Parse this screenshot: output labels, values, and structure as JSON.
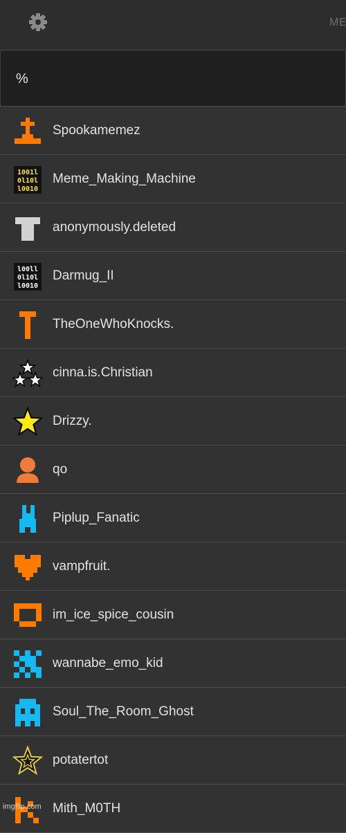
{
  "header": {
    "settings_icon": "gear-icon",
    "right_text": "ME"
  },
  "search": {
    "value": "%"
  },
  "users": [
    {
      "name": "Spookamemez",
      "avatar": "tombstone-cross-icon",
      "color": "#ff7a00"
    },
    {
      "name": "Meme_Making_Machine",
      "avatar": "binary-code-icon",
      "color": "#ffe23a"
    },
    {
      "name": "anonymously.deleted",
      "avatar": "shirt-icon",
      "color": "#d2d2d2"
    },
    {
      "name": "Darmug_II",
      "avatar": "binary-code-icon",
      "color": "#ffffff"
    },
    {
      "name": "TheOneWhoKnocks.",
      "avatar": "letter-t-icon",
      "color": "#ff7a00"
    },
    {
      "name": "cinna.is.Christian",
      "avatar": "three-stars-icon",
      "color": "#ffffff"
    },
    {
      "name": "Drizzy.",
      "avatar": "star-icon",
      "color": "#ffe817"
    },
    {
      "name": "qo",
      "avatar": "person-icon",
      "color": "#f07a3a"
    },
    {
      "name": "Piplup_Fanatic",
      "avatar": "pixel-creature-icon",
      "color": "#15b8f0"
    },
    {
      "name": "vampfruit.",
      "avatar": "pixel-heart-icon",
      "color": "#ff7a00"
    },
    {
      "name": "im_ice_spice_cousin",
      "avatar": "pixel-box-icon",
      "color": "#ff7a00"
    },
    {
      "name": "wannabe_emo_kid",
      "avatar": "pixel-pattern-icon",
      "color": "#15b8f0"
    },
    {
      "name": "Soul_The_Room_Ghost",
      "avatar": "pixel-ghost-icon",
      "color": "#15b8f0"
    },
    {
      "name": "potatertot",
      "avatar": "outlined-star-icon",
      "color": "#e6cf3a"
    },
    {
      "name": "Mith_M0TH",
      "avatar": "pixel-k-icon",
      "color": "#ff7a00"
    }
  ],
  "watermark": "imgflip.com"
}
